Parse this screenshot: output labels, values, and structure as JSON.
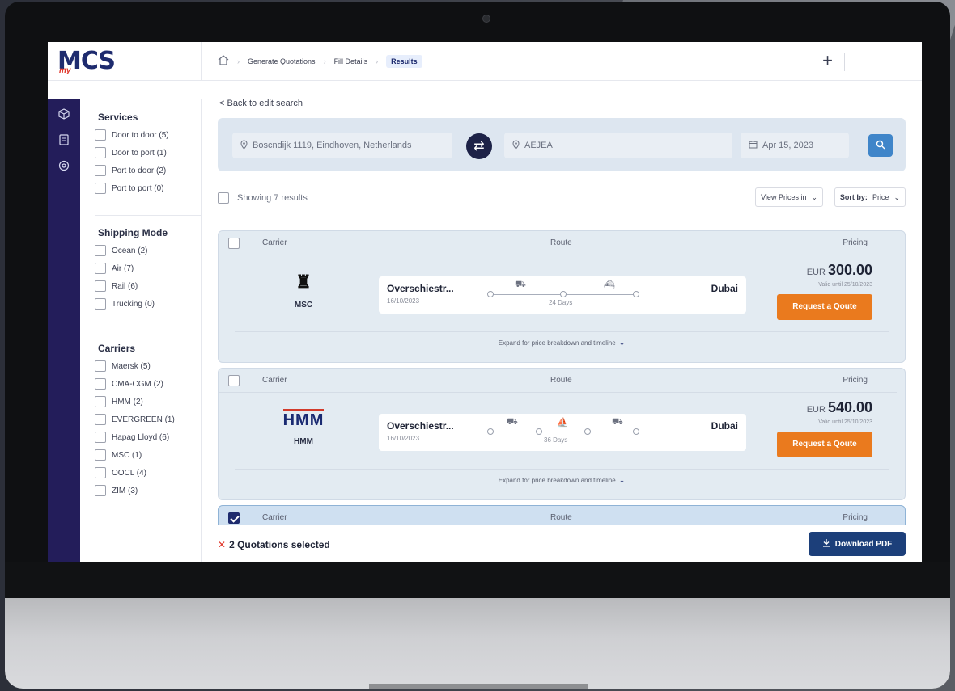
{
  "app": {
    "logo": "MCS",
    "logo_prefix": "my"
  },
  "breadcrumb": [
    {
      "label": "Generate Quotations"
    },
    {
      "label": "Fill Details"
    },
    {
      "label": "Results"
    }
  ],
  "topbar": {
    "plus": "+"
  },
  "sidebar_icons": [
    "box-icon",
    "document-icon",
    "settings-icon"
  ],
  "filters": {
    "services": {
      "title": "Services",
      "options": [
        "Door to door (5)",
        "Door to port (1)",
        "Port to door (2)",
        "Port to port (0)"
      ]
    },
    "shipping_mode": {
      "title": "Shipping Mode",
      "options": [
        "Ocean (2)",
        "Air (7)",
        "Rail (6)",
        "Trucking (0)"
      ]
    },
    "carriers": {
      "title": "Carriers",
      "options": [
        "Maersk (5)",
        "CMA-CGM (2)",
        "HMM (2)",
        "EVERGREEN (1)",
        "Hapag Lloyd (6)",
        "MSC (1)",
        "OOCL (4)",
        "ZIM (3)"
      ]
    }
  },
  "main": {
    "back_link": "< Back to edit search",
    "search": {
      "origin": "Boscndijk 1119, Eindhoven, Netherlands",
      "destination": "AEJEA",
      "date": "Apr 15, 2023"
    },
    "results_count": "Showing 7 results",
    "view_prices_label": "View Prices in",
    "sort_label": "Sort by:",
    "sort_value": "Price",
    "columns": {
      "carrier": "Carrier",
      "route": "Route",
      "pricing": "Pricing"
    },
    "cards": [
      {
        "carrier": "MSC",
        "origin": "Overschiestr...",
        "date": "16/10/2023",
        "destination": "Dubai",
        "duration": "24 Days",
        "currency": "EUR",
        "price": "300.00",
        "valid": "Valid until 25/10/2023",
        "cta": "Request a Qoute",
        "expand": "Expand for price breakdown and timeline"
      },
      {
        "carrier": "HMM",
        "origin": "Overschiestr...",
        "date": "16/10/2023",
        "destination": "Dubai",
        "duration": "36 Days",
        "currency": "EUR",
        "price": "540.00",
        "valid": "Valid until 25/10/2023",
        "cta": "Request a Qoute",
        "expand": "Expand for price breakdown and timeline"
      }
    ]
  },
  "selection": {
    "text": "2 Quotations selected",
    "download": "Download PDF"
  },
  "colors": {
    "brand": "#1e2b6e",
    "accent": "#ea7a1e",
    "rail": "#231d5a",
    "primary_button": "#1c3f7a"
  }
}
